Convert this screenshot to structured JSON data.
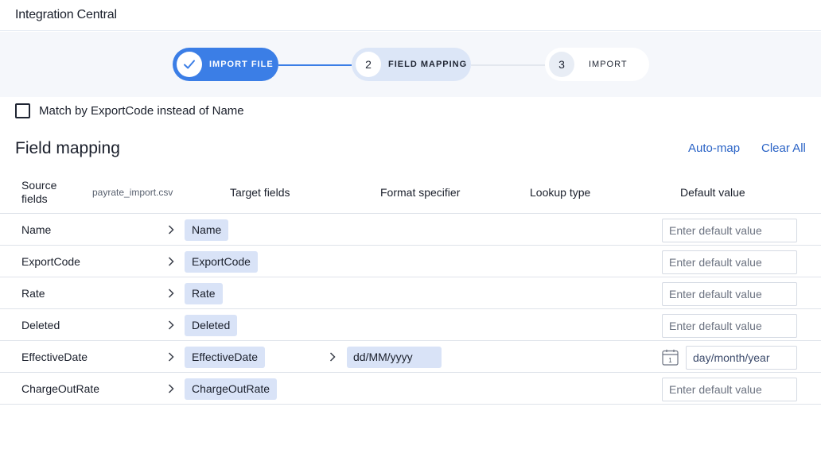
{
  "app": {
    "title": "Integration Central"
  },
  "stepper": {
    "steps": [
      {
        "number": "",
        "label": "IMPORT FILE",
        "status": "done"
      },
      {
        "number": "2",
        "label": "FIELD MAPPING",
        "status": "active"
      },
      {
        "number": "3",
        "label": "IMPORT",
        "status": "pending"
      }
    ]
  },
  "options": {
    "match_by_exportcode_label": "Match by ExportCode instead of Name",
    "match_by_exportcode_checked": false
  },
  "mapping": {
    "title": "Field mapping",
    "automap_label": "Auto-map",
    "clear_all_label": "Clear All",
    "columns": {
      "source": "Source fields",
      "file": "payrate_import.csv",
      "target": "Target fields",
      "format": "Format specifier",
      "lookup": "Lookup type",
      "default": "Default value"
    },
    "default_placeholder": "Enter default value",
    "rows": [
      {
        "source": "Name",
        "target": "Name",
        "format": "",
        "default": ""
      },
      {
        "source": "ExportCode",
        "target": "ExportCode",
        "format": "",
        "default": ""
      },
      {
        "source": "Rate",
        "target": "Rate",
        "format": "",
        "default": ""
      },
      {
        "source": "Deleted",
        "target": "Deleted",
        "format": "",
        "default": ""
      },
      {
        "source": "EffectiveDate",
        "target": "EffectiveDate",
        "format": "dd/MM/yyyy",
        "default": "day/month/year",
        "calendar_day": "1"
      },
      {
        "source": "ChargeOutRate",
        "target": "ChargeOutRate",
        "format": "",
        "default": ""
      }
    ]
  },
  "colors": {
    "accent": "#3b7ee6",
    "chip": "#d9e3f7",
    "link": "#2a63c6"
  },
  "icons": {
    "done_step": "check-icon",
    "row_arrow": "chevron-right-icon",
    "date": "calendar-icon"
  }
}
